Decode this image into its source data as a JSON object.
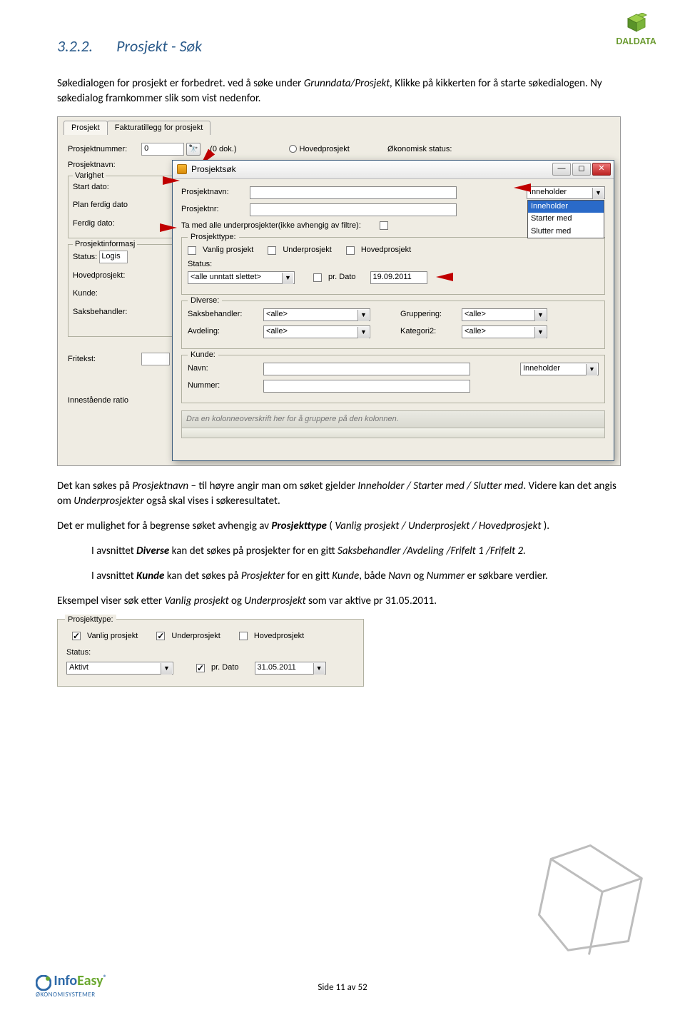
{
  "header_brand": "DALDATA",
  "section_number": "3.2.2.",
  "section_title": "Prosjekt - Søk",
  "para1_a": "Søkedialogen for prosjekt er forbedret. ved å søke under ",
  "para1_b": "Grunndata/Prosjekt,",
  "para1_c": " Klikke på kikkerten for å starte søkedialogen. Ny søkedialog framkommer slik som vist nedenfor.",
  "para2_a": "Det kan søkes på ",
  "para2_b": "Prosjektnavn",
  "para2_c": " – til høyre angir man om søket gjelder ",
  "para2_d": "Inneholder / Starter med / Slutter med",
  "para2_e": ". Videre kan det angis om ",
  "para2_f": "Underprosjekter",
  "para2_g": " også skal vises i søkeresultatet.",
  "para3_a": "Det er mulighet for å begrense søket avhengig av ",
  "para3_b": "Prosjekttype",
  "para3_c": " ( ",
  "para3_d": "Vanlig prosjekt / Underprosjekt / Hovedprosjekt",
  "para3_e": " ).",
  "para4_a": "I avsnittet ",
  "para4_b": "Diverse",
  "para4_c": " kan det søkes på prosjekter for en gitt ",
  "para4_d": "Saksbehandler /Avdeling /Frifelt 1 /Frifelt 2.",
  "para5_a": "I avsnittet ",
  "para5_b": "Kunde",
  "para5_c": " kan det søkes på ",
  "para5_d": "Prosjekter",
  "para5_e": " for en gitt ",
  "para5_f": "Kunde",
  "para5_g": ", både ",
  "para5_h": "Navn",
  "para5_i": " og ",
  "para5_j": "Nummer",
  "para5_k": " er søkbare verdier.",
  "para6_a": "Eksempel viser søk etter ",
  "para6_b": "Vanlig prosjekt",
  "para6_c": " og ",
  "para6_d": "Underprosjekt",
  "para6_e": " som var aktive pr 31.05.2011.",
  "footer_page": "Side 11 av 52",
  "footer_logo_sub": "ØKONOMISYSTEMER",
  "bg": {
    "tab1": "Prosjekt",
    "tab2": "Fakturatillegg for prosjekt",
    "l_prosjnr": "Prosjektnummer:",
    "v_prosjnr": "0",
    "dok": "(0 dok.)",
    "hovedprosjekt": "Hovedprosjekt",
    "okstatus": "Økonomisk status:",
    "l_prosjnavn": "Prosjektnavn:",
    "grp_varighet": "Varighet",
    "l_start": "Start dato:",
    "l_plan": "Plan ferdig dato",
    "l_ferdig": "Ferdig dato:",
    "grp_info": "Prosjektinformasj",
    "l_status": "Status:",
    "v_status": "Logis",
    "l_hoved": "Hovedprosjekt:",
    "l_kunde": "Kunde:",
    "l_saksbeh": "Saksbehandler:",
    "l_fritekst": "Fritekst:",
    "l_inne": "Innestående ratio"
  },
  "dlg": {
    "title": "Prosjektsøk",
    "l_navn": "Prosjektnavn:",
    "l_nr": "Prosjektnr:",
    "combo_value": "Inneholder",
    "combo_options": [
      "Inneholder",
      "Starter med",
      "Slutter med"
    ],
    "l_tamed": "Ta med alle underprosjekter(ikke avhengig av filtre):",
    "grp_type": "Prosjekttype:",
    "chk_vanlig": "Vanlig prosjekt",
    "chk_under": "Underprosjekt",
    "chk_hoved": "Hovedprosjekt",
    "l_status": "Status:",
    "v_status": "<alle unntatt slettet>",
    "l_prdato": "pr. Dato",
    "v_date": "19.09.2011",
    "grp_div": "Diverse:",
    "l_saks": "Saksbehandler:",
    "l_avd": "Avdeling:",
    "l_grupp": "Gruppering:",
    "l_kat2": "Kategori2:",
    "v_alle": "<alle>",
    "grp_kunde": "Kunde:",
    "l_knavn": "Navn:",
    "l_knr": "Nummer:",
    "v_inneholder": "Inneholder",
    "groupbar": "Dra en kolonneoverskrift her for å gruppere på den kolonnen."
  },
  "shot2": {
    "grp_type": "Prosjekttype:",
    "chk_vanlig": "Vanlig prosjekt",
    "chk_under": "Underprosjekt",
    "chk_hoved": "Hovedprosjekt",
    "l_status": "Status:",
    "v_status": "Aktivt",
    "l_prdato": "pr. Dato",
    "v_date": "31.05.2011"
  }
}
